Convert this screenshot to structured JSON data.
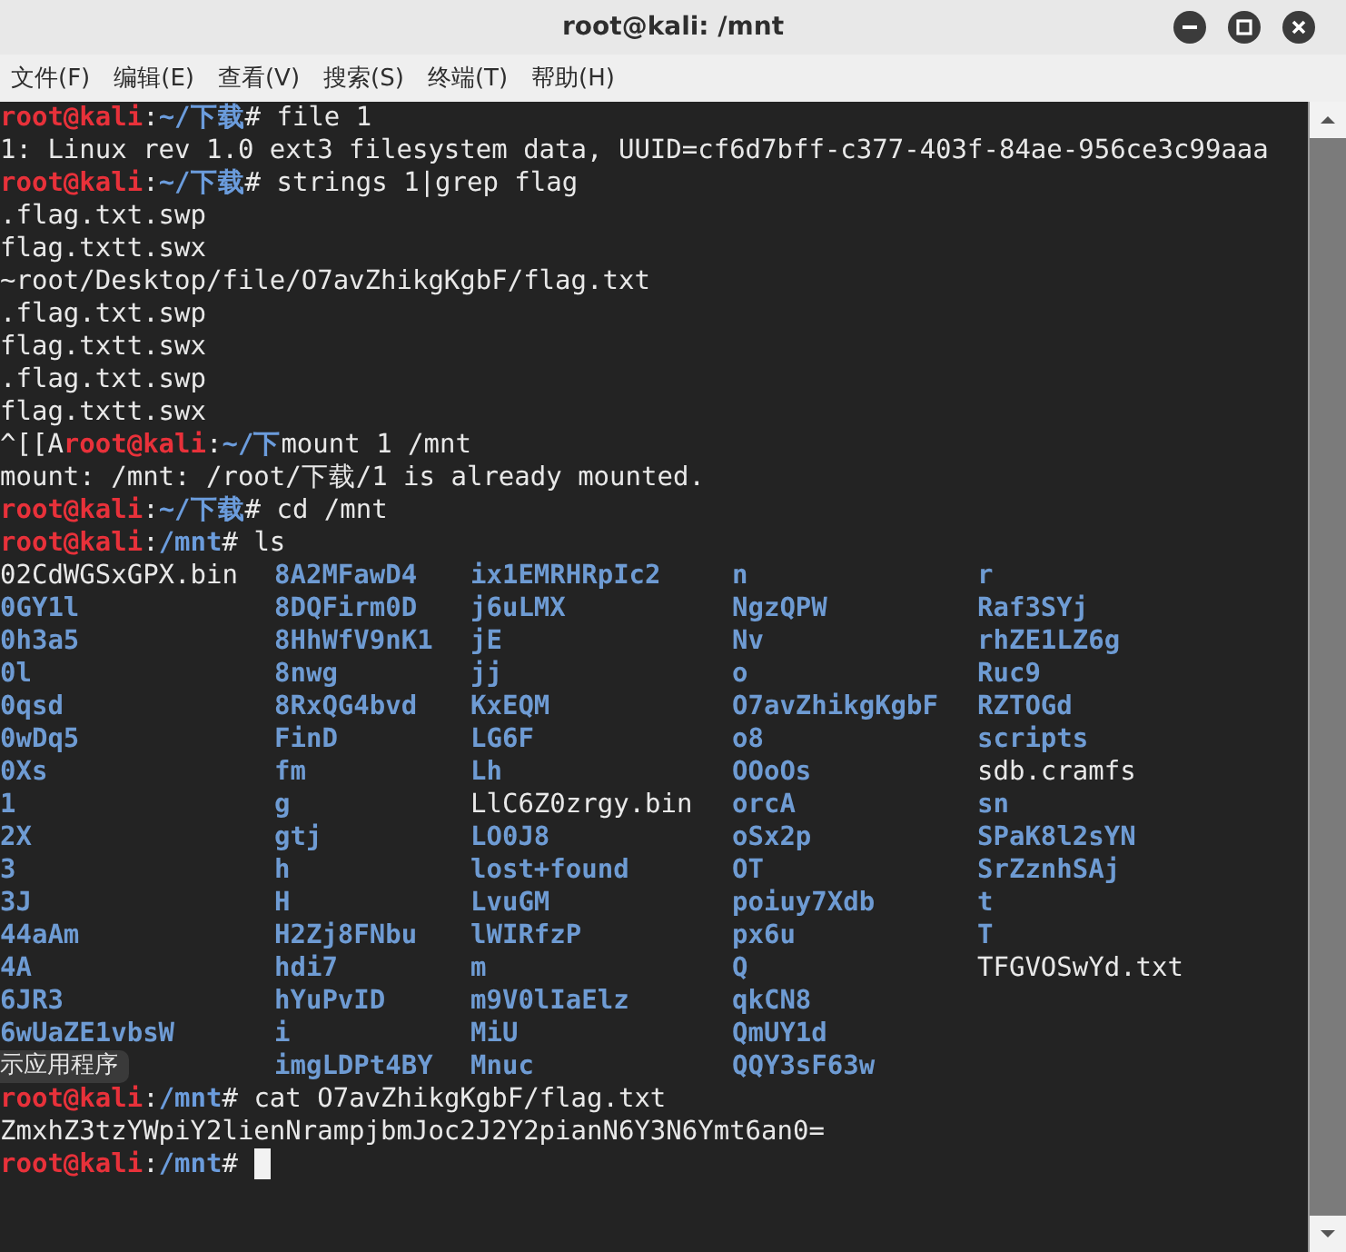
{
  "window": {
    "title": "root@kali: /mnt"
  },
  "menu": [
    {
      "label": "文件(F)"
    },
    {
      "label": "编辑(E)"
    },
    {
      "label": "查看(V)"
    },
    {
      "label": "搜索(S)"
    },
    {
      "label": "终端(T)"
    },
    {
      "label": "帮助(H)"
    }
  ],
  "terminal": {
    "blocks": [
      {
        "kind": "line",
        "cursor": false,
        "segments": [
          {
            "kind": "user",
            "text": "root@kali"
          },
          {
            "kind": "text",
            "text": ":"
          },
          {
            "kind": "path",
            "text": "~/下载"
          },
          {
            "kind": "text",
            "text": "# file 1"
          }
        ]
      },
      {
        "kind": "line",
        "cursor": false,
        "segments": [
          {
            "kind": "text",
            "text": "1: Linux rev 1.0 ext3 filesystem data, UUID=cf6d7bff-c377-403f-84ae-956ce3c99aaa"
          }
        ]
      },
      {
        "kind": "line",
        "cursor": false,
        "segments": [
          {
            "kind": "user",
            "text": "root@kali"
          },
          {
            "kind": "text",
            "text": ":"
          },
          {
            "kind": "path",
            "text": "~/下载"
          },
          {
            "kind": "text",
            "text": "# strings 1|grep flag"
          }
        ]
      },
      {
        "kind": "line",
        "cursor": false,
        "segments": [
          {
            "kind": "text",
            "text": ".flag.txt.swp"
          }
        ]
      },
      {
        "kind": "line",
        "cursor": false,
        "segments": [
          {
            "kind": "text",
            "text": "flag.txtt.swx"
          }
        ]
      },
      {
        "kind": "line",
        "cursor": false,
        "segments": [
          {
            "kind": "text",
            "text": "~root/Desktop/file/O7avZhikgKgbF/flag.txt"
          }
        ]
      },
      {
        "kind": "line",
        "cursor": false,
        "segments": [
          {
            "kind": "text",
            "text": ".flag.txt.swp"
          }
        ]
      },
      {
        "kind": "line",
        "cursor": false,
        "segments": [
          {
            "kind": "text",
            "text": "flag.txtt.swx"
          }
        ]
      },
      {
        "kind": "line",
        "cursor": false,
        "segments": [
          {
            "kind": "text",
            "text": ".flag.txt.swp"
          }
        ]
      },
      {
        "kind": "line",
        "cursor": false,
        "segments": [
          {
            "kind": "text",
            "text": "flag.txtt.swx"
          }
        ]
      },
      {
        "kind": "line",
        "cursor": false,
        "segments": [
          {
            "kind": "text",
            "text": "^[[A"
          },
          {
            "kind": "user",
            "text": "root@kali"
          },
          {
            "kind": "text",
            "text": ":"
          },
          {
            "kind": "path",
            "text": "~/下"
          },
          {
            "kind": "text",
            "text": "mount 1 /mnt"
          }
        ]
      },
      {
        "kind": "line",
        "cursor": false,
        "segments": [
          {
            "kind": "text",
            "text": "mount: /mnt: /root/下载/1 is already mounted."
          }
        ]
      },
      {
        "kind": "line",
        "cursor": false,
        "segments": [
          {
            "kind": "user",
            "text": "root@kali"
          },
          {
            "kind": "text",
            "text": ":"
          },
          {
            "kind": "path",
            "text": "~/下载"
          },
          {
            "kind": "text",
            "text": "# cd /mnt"
          }
        ]
      },
      {
        "kind": "line",
        "cursor": false,
        "segments": [
          {
            "kind": "user",
            "text": "root@kali"
          },
          {
            "kind": "text",
            "text": ":"
          },
          {
            "kind": "path",
            "text": "/mnt"
          },
          {
            "kind": "text",
            "text": "# ls"
          }
        ]
      },
      {
        "kind": "listing",
        "tooltip": {
          "text": "示应用程序"
        },
        "columns": [
          [
            {
              "name": "02CdWGSxGPX.bin",
              "kind": "file"
            },
            {
              "name": "0GY1l",
              "kind": "dir"
            },
            {
              "name": "0h3a5",
              "kind": "dir"
            },
            {
              "name": "0l",
              "kind": "dir"
            },
            {
              "name": "0qsd",
              "kind": "dir"
            },
            {
              "name": "0wDq5",
              "kind": "dir"
            },
            {
              "name": "0Xs",
              "kind": "dir"
            },
            {
              "name": "1",
              "kind": "dir"
            },
            {
              "name": "2X",
              "kind": "dir"
            },
            {
              "name": "3",
              "kind": "dir"
            },
            {
              "name": "3J",
              "kind": "dir"
            },
            {
              "name": "44aAm",
              "kind": "dir"
            },
            {
              "name": "4A",
              "kind": "dir"
            },
            {
              "name": "6JR3",
              "kind": "dir"
            },
            {
              "name": "6wUaZE1vbsW",
              "kind": "dir"
            }
          ],
          [
            {
              "name": "8A2MFawD4",
              "kind": "dir"
            },
            {
              "name": "8DQFirm0D",
              "kind": "dir"
            },
            {
              "name": "8HhWfV9nK1",
              "kind": "dir"
            },
            {
              "name": "8nwg",
              "kind": "dir"
            },
            {
              "name": "8RxQG4bvd",
              "kind": "dir"
            },
            {
              "name": "FinD",
              "kind": "dir"
            },
            {
              "name": "fm",
              "kind": "dir"
            },
            {
              "name": "g",
              "kind": "dir"
            },
            {
              "name": "gtj",
              "kind": "dir"
            },
            {
              "name": "h",
              "kind": "dir"
            },
            {
              "name": "H",
              "kind": "dir"
            },
            {
              "name": "H2Zj8FNbu",
              "kind": "dir"
            },
            {
              "name": "hdi7",
              "kind": "dir"
            },
            {
              "name": "hYuPvID",
              "kind": "dir"
            },
            {
              "name": "i",
              "kind": "dir"
            },
            {
              "name": "imgLDPt4BY",
              "kind": "dir"
            }
          ],
          [
            {
              "name": "ix1EMRHRpIc2",
              "kind": "dir"
            },
            {
              "name": "j6uLMX",
              "kind": "dir"
            },
            {
              "name": "jE",
              "kind": "dir"
            },
            {
              "name": "jj",
              "kind": "dir"
            },
            {
              "name": "KxEQM",
              "kind": "dir"
            },
            {
              "name": "LG6F",
              "kind": "dir"
            },
            {
              "name": "Lh",
              "kind": "dir"
            },
            {
              "name": "LlC6Z0zrgy.bin",
              "kind": "file"
            },
            {
              "name": "LO0J8",
              "kind": "dir"
            },
            {
              "name": "lost+found",
              "kind": "dir"
            },
            {
              "name": "LvuGM",
              "kind": "dir"
            },
            {
              "name": "lWIRfzP",
              "kind": "dir"
            },
            {
              "name": "m",
              "kind": "dir"
            },
            {
              "name": "m9V0lIaElz",
              "kind": "dir"
            },
            {
              "name": "MiU",
              "kind": "dir"
            },
            {
              "name": "Mnuc",
              "kind": "dir"
            }
          ],
          [
            {
              "name": "n",
              "kind": "dir"
            },
            {
              "name": "NgzQPW",
              "kind": "dir"
            },
            {
              "name": "Nv",
              "kind": "dir"
            },
            {
              "name": "o",
              "kind": "dir"
            },
            {
              "name": "O7avZhikgKgbF",
              "kind": "dir"
            },
            {
              "name": "o8",
              "kind": "dir"
            },
            {
              "name": "OOoOs",
              "kind": "dir"
            },
            {
              "name": "orcA",
              "kind": "dir"
            },
            {
              "name": "oSx2p",
              "kind": "dir"
            },
            {
              "name": "OT",
              "kind": "dir"
            },
            {
              "name": "poiuy7Xdb",
              "kind": "dir"
            },
            {
              "name": "px6u",
              "kind": "dir"
            },
            {
              "name": "Q",
              "kind": "dir"
            },
            {
              "name": "qkCN8",
              "kind": "dir"
            },
            {
              "name": "QmUY1d",
              "kind": "dir"
            },
            {
              "name": "QQY3sF63w",
              "kind": "dir"
            }
          ],
          [
            {
              "name": "r",
              "kind": "dir"
            },
            {
              "name": "Raf3SYj",
              "kind": "dir"
            },
            {
              "name": "rhZE1LZ6g",
              "kind": "dir"
            },
            {
              "name": "Ruc9",
              "kind": "dir"
            },
            {
              "name": "RZTOGd",
              "kind": "dir"
            },
            {
              "name": "scripts",
              "kind": "dir"
            },
            {
              "name": "sdb.cramfs",
              "kind": "file"
            },
            {
              "name": "sn",
              "kind": "dir"
            },
            {
              "name": "SPaK8l2sYN",
              "kind": "dir"
            },
            {
              "name": "SrZznhSAj",
              "kind": "dir"
            },
            {
              "name": "t",
              "kind": "dir"
            },
            {
              "name": "T",
              "kind": "dir"
            },
            {
              "name": "TFGVOSwYd.txt",
              "kind": "file"
            }
          ]
        ]
      },
      {
        "kind": "line",
        "cursor": false,
        "segments": [
          {
            "kind": "user",
            "text": "root@kali"
          },
          {
            "kind": "text",
            "text": ":"
          },
          {
            "kind": "path",
            "text": "/mnt"
          },
          {
            "kind": "text",
            "text": "# cat O7avZhikgKgbF/flag.txt"
          }
        ]
      },
      {
        "kind": "line",
        "cursor": false,
        "segments": [
          {
            "kind": "text",
            "text": "ZmxhZ3tzYWpiY2lienNrampjbmJoc2J2Y2pianN6Y3N6Ymt6an0="
          }
        ]
      },
      {
        "kind": "line",
        "cursor": true,
        "segments": [
          {
            "kind": "user",
            "text": "root@kali"
          },
          {
            "kind": "text",
            "text": ":"
          },
          {
            "kind": "path",
            "text": "/mnt"
          },
          {
            "kind": "text",
            "text": "# "
          }
        ]
      }
    ]
  }
}
